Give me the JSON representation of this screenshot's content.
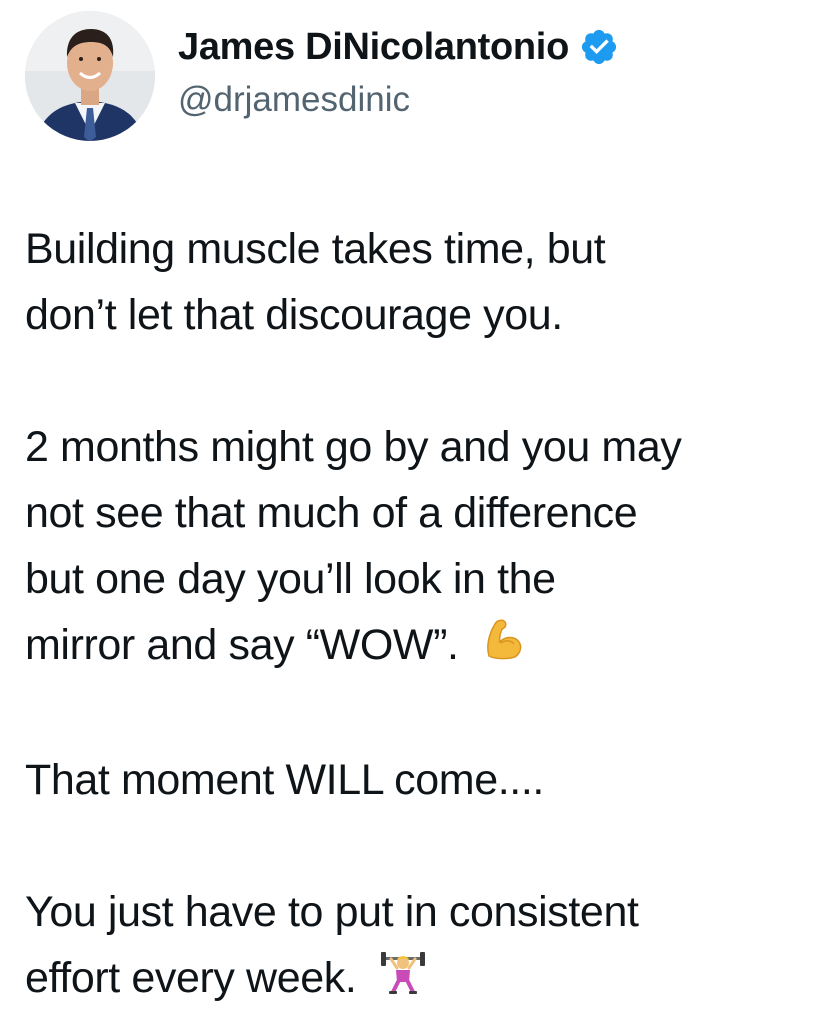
{
  "author": {
    "display_name": "James DiNicolantonio",
    "handle": "@drjamesdinic",
    "verified_icon": "verified-badge-icon",
    "verified_color": "#1d9bf0"
  },
  "tweet": {
    "paragraph_1": {
      "line_1": "Building muscle takes time, but",
      "line_2": "don’t let that discourage you."
    },
    "paragraph_2": {
      "line_1": "2 months might go by and you may",
      "line_2": "not see that much of a difference",
      "line_3": "but one day you’ll look in the",
      "line_4": "mirror and say “WOW”."
    },
    "paragraph_3": {
      "line_1": "That moment WILL come...."
    },
    "paragraph_4": {
      "line_1": "You just have to put in consistent",
      "line_2": "effort every week."
    },
    "emojis": [
      "flexed-biceps-icon",
      "weightlifter-icon"
    ]
  },
  "colors": {
    "text": "#0f1419",
    "secondary_text": "#536471",
    "background": "#ffffff"
  }
}
